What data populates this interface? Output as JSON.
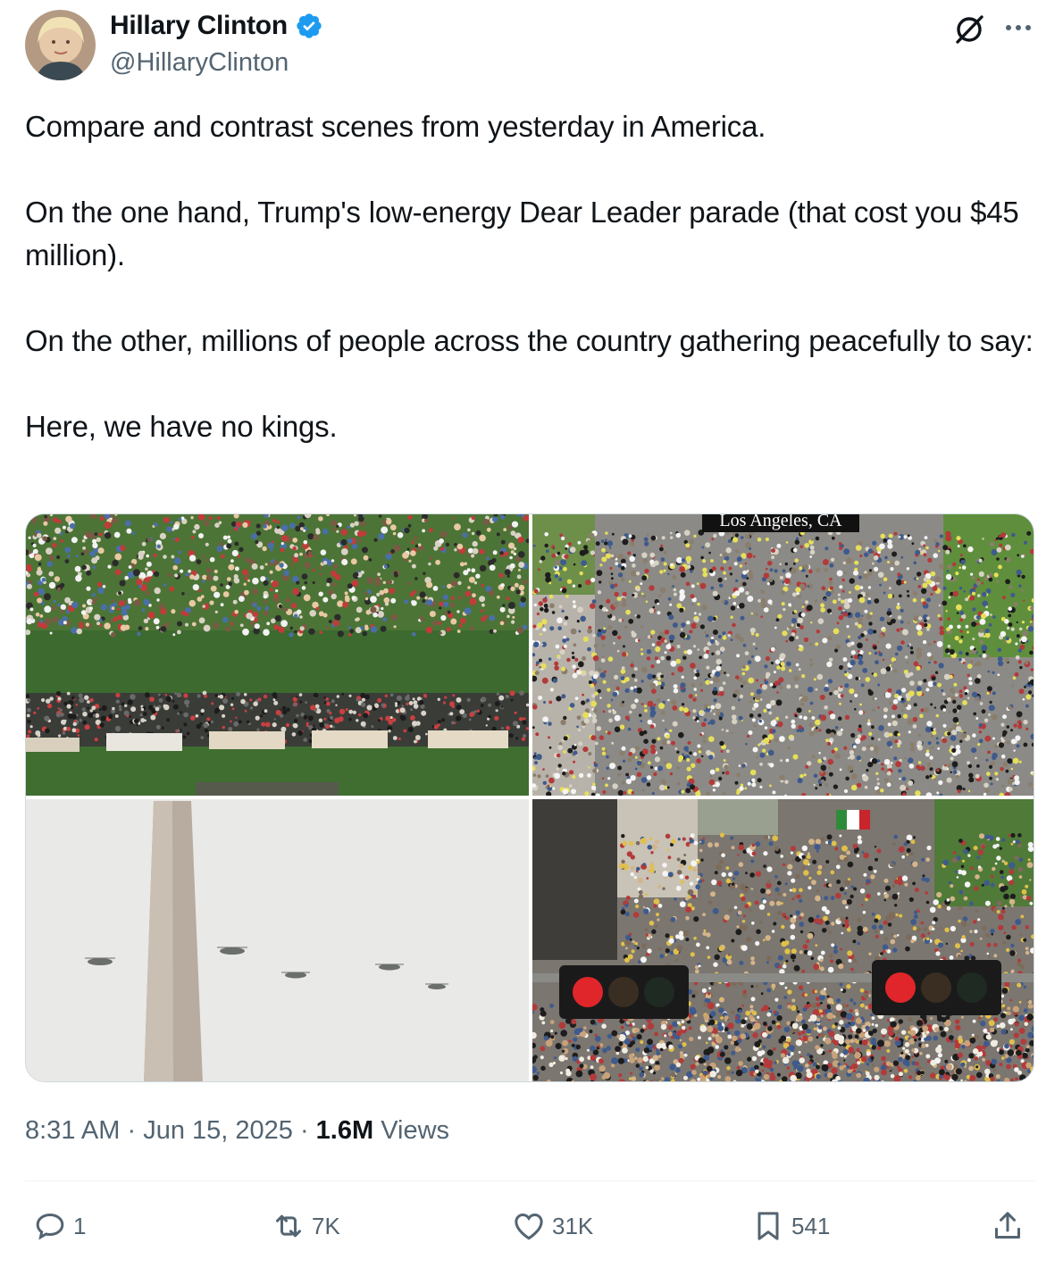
{
  "author": {
    "display_name": "Hillary Clinton",
    "handle": "@HillaryClinton",
    "verified": true
  },
  "tweet": {
    "paragraphs": [
      "Compare and contrast scenes from yesterday in America.",
      "On the one hand, Trump's low-energy Dear Leader parade (that cost you $45 million).",
      "On the other, millions of people across the country gathering peacefully to say:",
      "Here, we have no kings."
    ]
  },
  "media": {
    "overlay_label": "Los Angeles, CA"
  },
  "meta": {
    "time": "8:31 AM",
    "date": "Jun 15, 2025",
    "views_count": "1.6M",
    "views_label": "Views"
  },
  "actions": {
    "replies": "1",
    "reposts": "7K",
    "likes": "31K",
    "bookmarks": "541"
  },
  "colors": {
    "verified_blue": "#1d9bf0",
    "secondary_text": "#536471",
    "primary_text": "#0f1419"
  },
  "icons": [
    "verified-badge-icon",
    "grok-icon",
    "more-icon",
    "reply-icon",
    "repost-icon",
    "like-icon",
    "bookmark-icon",
    "share-icon"
  ]
}
